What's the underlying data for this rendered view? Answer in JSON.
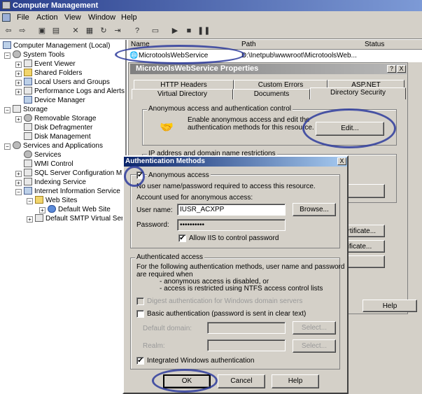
{
  "window": {
    "title": "Computer Management"
  },
  "menu": [
    "File",
    "Action",
    "View",
    "Window",
    "Help"
  ],
  "tree": [
    {
      "label": "Computer Management (Local)",
      "level": 0,
      "icon": "computer-icon"
    },
    {
      "label": "System Tools",
      "level": 1,
      "icon": "tools-icon"
    },
    {
      "label": "Event Viewer",
      "level": 2,
      "icon": "event-viewer-icon"
    },
    {
      "label": "Shared Folders",
      "level": 2,
      "icon": "folder-icon"
    },
    {
      "label": "Local Users and Groups",
      "level": 2,
      "icon": "users-icon"
    },
    {
      "label": "Performance Logs and Alerts",
      "level": 2,
      "icon": "performance-icon"
    },
    {
      "label": "Device Manager",
      "level": 2,
      "icon": "device-manager-icon"
    },
    {
      "label": "Storage",
      "level": 1,
      "icon": "storage-icon"
    },
    {
      "label": "Removable Storage",
      "level": 2,
      "icon": "removable-storage-icon"
    },
    {
      "label": "Disk Defragmenter",
      "level": 2,
      "icon": "defrag-icon"
    },
    {
      "label": "Disk Management",
      "level": 2,
      "icon": "disk-icon"
    },
    {
      "label": "Services and Applications",
      "level": 1,
      "icon": "services-icon"
    },
    {
      "label": "Services",
      "level": 2,
      "icon": "gear-icon"
    },
    {
      "label": "WMI Control",
      "level": 2,
      "icon": "wmi-icon"
    },
    {
      "label": "SQL Server Configuration M",
      "level": 2,
      "icon": "sql-icon"
    },
    {
      "label": "Indexing Service",
      "level": 2,
      "icon": "indexing-icon"
    },
    {
      "label": "Internet Information Service",
      "level": 2,
      "icon": "iis-icon"
    },
    {
      "label": "Web Sites",
      "level": 3,
      "icon": "folder-icon"
    },
    {
      "label": "Default Web Site",
      "level": 4,
      "icon": "globe-icon"
    },
    {
      "label": "Default SMTP Virtual Ser",
      "level": 3,
      "icon": "smtp-icon"
    }
  ],
  "list": {
    "headers": [
      "Name",
      "Path",
      "Status"
    ],
    "row": {
      "name": "MicrotoolsWebService",
      "path": "D:\\Inetpub\\wwwroot\\MicrotoolsWeb..."
    }
  },
  "props": {
    "title": "MicrotoolsWebService Properties",
    "help_btn": "?",
    "close_btn": "X",
    "tabs_back": [
      "HTTP Headers",
      "Custom Errors",
      "ASP.NET"
    ],
    "tabs_front": [
      "Virtual Directory",
      "Documents",
      "Directory Security"
    ],
    "anon_group": "Anonymous access and authentication control",
    "anon_text1": "Enable anonymous access and edit the",
    "anon_text2": "authentication methods for this resource.",
    "edit_btn": "Edit...",
    "ip_group": "IP address and domain name restrictions",
    "cert_btn1": "ertificate...",
    "cert_btn2": "ificate...",
    "help": "Help"
  },
  "dialog": {
    "title": "Authentication Methods",
    "close": "X",
    "anon_label": "Anonymous access",
    "anon_checked": true,
    "no_user": "No user name/password required to access this resource.",
    "account_label": "Account used for anonymous access:",
    "user_label": "User name:",
    "user_value": "IUSR_ACXPP",
    "browse": "Browse...",
    "password_label": "Password:",
    "password_value": "••••••••••",
    "allow_iis": "Allow IIS to control password",
    "allow_checked": true,
    "auth_group": "Authenticated access",
    "auth_desc1": "For the following authentication methods, user name and password",
    "auth_desc2": "are required when",
    "auth_bullet1": "- anonymous access is disabled, or",
    "auth_bullet2": "- access is restricted using NTFS access control lists",
    "digest": "Digest authentication for Windows domain servers",
    "basic": "Basic authentication (password is sent in clear text)",
    "default_domain": "Default domain:",
    "realm": "Realm:",
    "select": "Select...",
    "integrated": "Integrated Windows authentication",
    "integrated_checked": true,
    "ok": "OK",
    "cancel": "Cancel",
    "help": "Help"
  }
}
